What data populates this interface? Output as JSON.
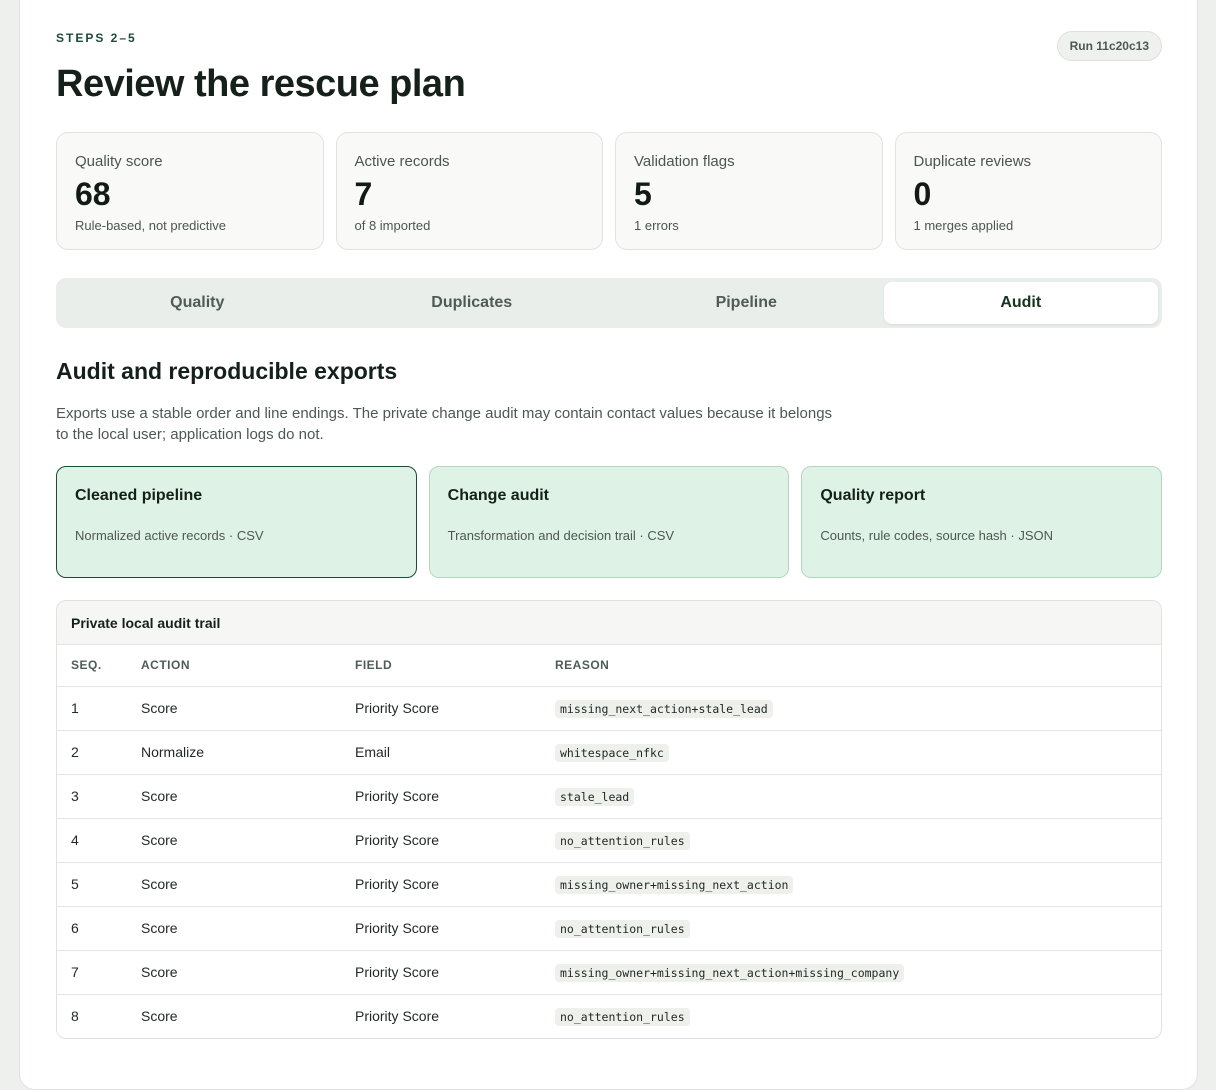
{
  "header": {
    "eyebrow": "STEPS 2–5",
    "title": "Review the rescue plan",
    "run_badge": "Run 11c20c13"
  },
  "metrics": [
    {
      "label": "Quality score",
      "value": "68",
      "sub": "Rule-based, not predictive"
    },
    {
      "label": "Active records",
      "value": "7",
      "sub": "of 8 imported"
    },
    {
      "label": "Validation flags",
      "value": "5",
      "sub": "1 errors"
    },
    {
      "label": "Duplicate reviews",
      "value": "0",
      "sub": "1 merges applied"
    }
  ],
  "tabs": [
    {
      "label": "Quality",
      "active": false
    },
    {
      "label": "Duplicates",
      "active": false
    },
    {
      "label": "Pipeline",
      "active": false
    },
    {
      "label": "Audit",
      "active": true
    }
  ],
  "section": {
    "title": "Audit and reproducible exports",
    "description": "Exports use a stable order and line endings. The private change audit may contain contact values because it belongs to the local user; application logs do not."
  },
  "exports": [
    {
      "title": "Cleaned pipeline",
      "desc": "Normalized active records · CSV",
      "selected": true
    },
    {
      "title": "Change audit",
      "desc": "Transformation and decision trail · CSV",
      "selected": false
    },
    {
      "title": "Quality report",
      "desc": "Counts, rule codes, source hash · JSON",
      "selected": false
    }
  ],
  "audit": {
    "title": "Private local audit trail",
    "columns": [
      "SEQ.",
      "ACTION",
      "FIELD",
      "REASON"
    ],
    "rows": [
      {
        "seq": "1",
        "action": "Score",
        "field": "Priority Score",
        "reason": "missing_next_action+stale_lead"
      },
      {
        "seq": "2",
        "action": "Normalize",
        "field": "Email",
        "reason": "whitespace_nfkc"
      },
      {
        "seq": "3",
        "action": "Score",
        "field": "Priority Score",
        "reason": "stale_lead"
      },
      {
        "seq": "4",
        "action": "Score",
        "field": "Priority Score",
        "reason": "no_attention_rules"
      },
      {
        "seq": "5",
        "action": "Score",
        "field": "Priority Score",
        "reason": "missing_owner+missing_next_action"
      },
      {
        "seq": "6",
        "action": "Score",
        "field": "Priority Score",
        "reason": "no_attention_rules"
      },
      {
        "seq": "7",
        "action": "Score",
        "field": "Priority Score",
        "reason": "missing_owner+missing_next_action+missing_company"
      },
      {
        "seq": "8",
        "action": "Score",
        "field": "Priority Score",
        "reason": "no_attention_rules"
      }
    ]
  }
}
